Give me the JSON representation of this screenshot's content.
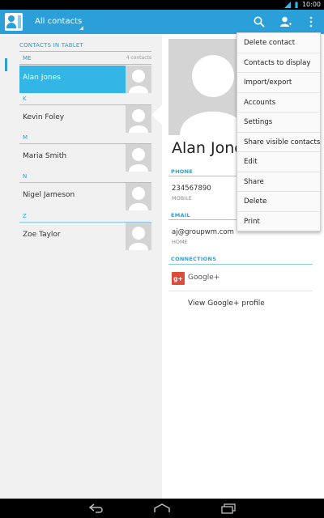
{
  "status_bar": {
    "time": "10:00",
    "signal_icon": "signal-icon",
    "battery_icon": "battery-icon"
  },
  "action_bar": {
    "app_icon": "contacts-app-icon",
    "filter_label": "All contacts",
    "search_icon": "search-icon",
    "add_contact_icon": "add-contact-icon",
    "overflow_icon": "overflow-menu-icon",
    "accent_color": "#2a9fd8"
  },
  "contacts_list": {
    "header": "CONTACTS IN TABLET",
    "me_section": {
      "letter": "ME",
      "count": "4 contacts"
    },
    "sections": [
      {
        "letter": "K"
      },
      {
        "letter": "M"
      },
      {
        "letter": "N"
      },
      {
        "letter": "Z"
      }
    ],
    "contacts": [
      {
        "name": "Alan Jones",
        "selected": true
      },
      {
        "name": "Kevin Foley",
        "selected": false
      },
      {
        "name": "Maria Smith",
        "selected": false
      },
      {
        "name": "Nigel Jameson",
        "selected": false
      },
      {
        "name": "Zoe Taylor",
        "selected": false
      }
    ]
  },
  "contact_detail": {
    "name": "Alan Jone",
    "phone_label": "PHONE",
    "phone_number": "234567890",
    "phone_type": "MOBILE",
    "email_label": "EMAIL",
    "email_address": "aj@groupwm.com",
    "email_type": "HOME",
    "connections_label": "CONNECTIONS",
    "gplus_logo": "g+",
    "gplus_label": "Google+",
    "gplus_profile": "View Google+ profile"
  },
  "overflow_menu": {
    "items": [
      "Delete contact",
      "Contacts to display",
      "Import/export",
      "Accounts",
      "Settings",
      "Share visible contacts",
      "Edit",
      "Share",
      "Delete",
      "Print"
    ]
  },
  "nav_bar": {
    "back_icon": "back-icon",
    "home_icon": "home-icon",
    "recents_icon": "recent-apps-icon"
  }
}
